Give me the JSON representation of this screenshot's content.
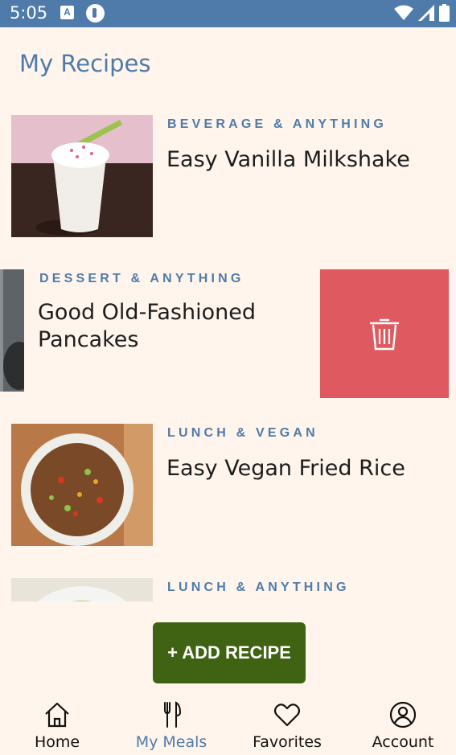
{
  "status_bar": {
    "time": "5:05",
    "icons": [
      "a-icon",
      "app-icon",
      "wifi-icon",
      "signal-icon",
      "battery-icon"
    ]
  },
  "page": {
    "title": "My Recipes"
  },
  "recipes": [
    {
      "category": "BEVERAGE & ANYTHING",
      "name": "Easy Vanilla Milkshake",
      "thumb": "milkshake-image"
    },
    {
      "category": "DESSERT & ANYTHING",
      "name": "Good Old-Fashioned Pancakes",
      "thumb": "pancakes-image",
      "swiped": true
    },
    {
      "category": "LUNCH & VEGAN",
      "name": "Easy Vegan Fried Rice",
      "thumb": "fried-rice-image"
    },
    {
      "category": "LUNCH & ANYTHING",
      "name": "",
      "thumb": "salad-image"
    }
  ],
  "swipe_action": {
    "icon": "trash-icon",
    "color": "#DF5A60"
  },
  "fab": {
    "label": "+ ADD RECIPE",
    "color": "#3F6313"
  },
  "bottom_nav": {
    "active": "My Meals",
    "items": [
      {
        "label": "Home",
        "icon": "home-icon"
      },
      {
        "label": "My Meals",
        "icon": "fork-knife-icon"
      },
      {
        "label": "Favorites",
        "icon": "heart-icon"
      },
      {
        "label": "Account",
        "icon": "account-icon"
      }
    ]
  },
  "colors": {
    "accent": "#4F7BAA",
    "background": "#FFF5EC",
    "danger": "#DF5A60",
    "fab": "#3F6313"
  }
}
